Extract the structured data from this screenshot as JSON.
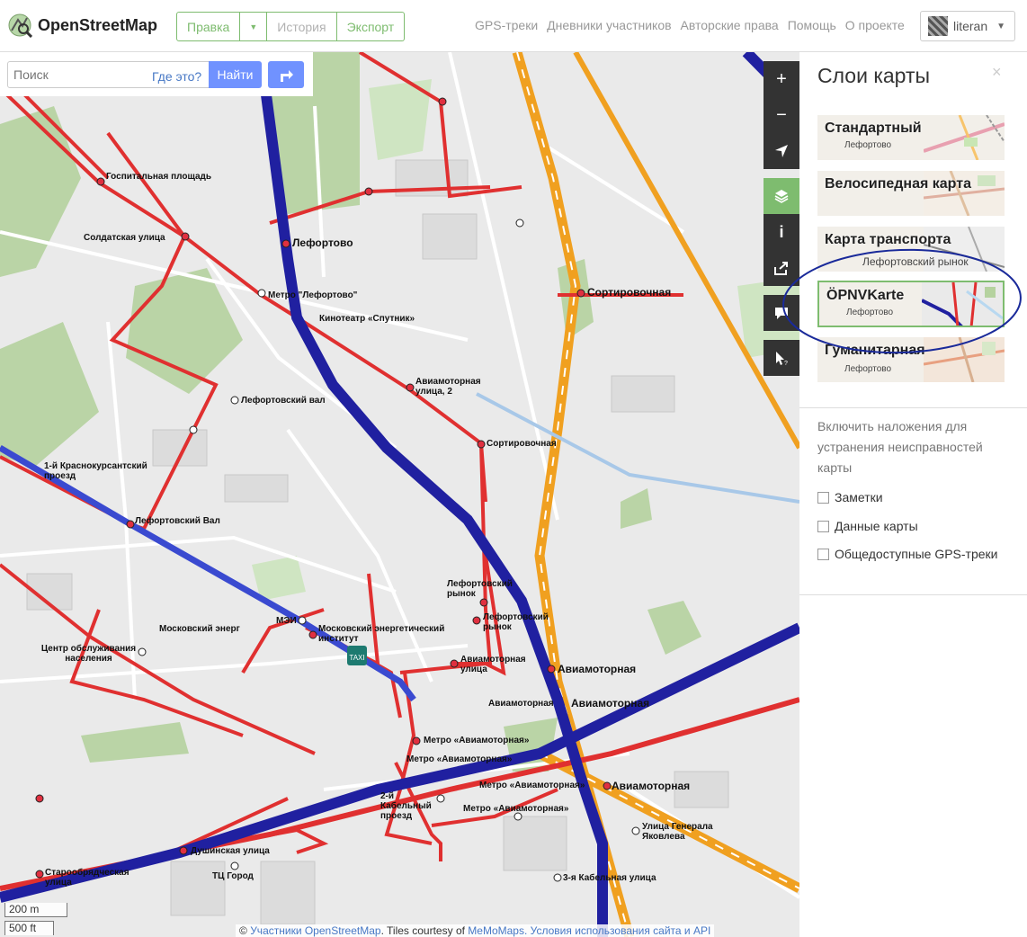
{
  "header": {
    "logo_text": "OpenStreetMap",
    "edit_label": "Правка",
    "history_label": "История",
    "export_label": "Экспорт",
    "nav": [
      "GPS-треки",
      "Дневники участников",
      "Авторские права",
      "Помощь",
      "О проекте"
    ],
    "username": "literan"
  },
  "search": {
    "placeholder": "Поиск",
    "where_link": "Где это?",
    "submit_label": "Найти"
  },
  "controls": [
    "zoom-in",
    "zoom-out",
    "locate",
    "layers",
    "info",
    "share",
    "note",
    "query"
  ],
  "sidebar": {
    "title": "Слои карты",
    "close": "×",
    "layers": [
      {
        "name": "Стандартный",
        "sub": "Лефортово",
        "selected": false
      },
      {
        "name": "Велосипедная карта",
        "sub": "",
        "selected": false
      },
      {
        "name": "Карта транспорта",
        "sub": "Лефортовский рынок",
        "selected": false
      },
      {
        "name": "ÖPNVKarte",
        "sub": "Лефортово",
        "selected": true
      },
      {
        "name": "Гуманитарная",
        "sub": "Лефортово",
        "selected": false
      }
    ],
    "overlay_note": "Включить наложения для устранения неисправностей карты",
    "overlays": [
      "Заметки",
      "Данные карты",
      "Общедоступные GPS-треки"
    ]
  },
  "map": {
    "labels": [
      "Госпитальная площадь",
      "Солдатская улица",
      "Лефортово",
      "Метро \"Лефортово\"",
      "Кинотеатр «Спутник»",
      "Сортировочная",
      "Авиамоторная улица, 2",
      "Лефортовский вал",
      "1-й Краснокурсантский проезд",
      "Лефортовский Вал",
      "Лефортовский рынок",
      "Московский энерг",
      "МЭИ",
      "Московский энергетический институт",
      "Центр обслуживания населения",
      "Авиамоторная улица",
      "Авиамоторная",
      "Метро «Авиамоторная»",
      "2-й Кабельный проезд",
      "Улица Генерала Яковлева",
      "Душинская улица",
      "ТЦ Город",
      "Старообрядческая улица",
      "3-я Кабельная улица"
    ],
    "scale": [
      "200 m",
      "500 ft"
    ],
    "attribution_prefix": "©",
    "attribution_osm": "Участники OpenStreetMap",
    "attribution_mid": ". Tiles courtesy of",
    "attribution_memo": "MeMoMaps",
    "attribution_terms": ". Условия использования сайта и API"
  },
  "colors": {
    "accent": "#7ebc6f",
    "search_button": "#7092ff",
    "tram": "#e03030",
    "metro": "#2020a0",
    "rail": "#f0a020",
    "annotation": "#1a2a9a"
  }
}
